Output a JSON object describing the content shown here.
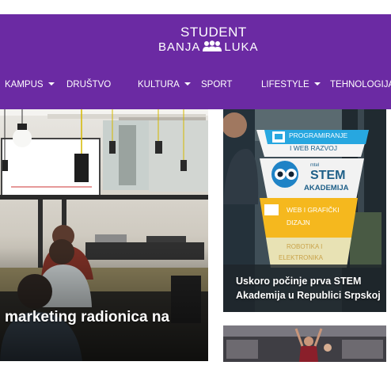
{
  "brand": {
    "line1": "STUDENT",
    "line2_left": "BANJA",
    "line2_right": "LUKA",
    "header_color": "#6b2aa3"
  },
  "nav": {
    "items": [
      {
        "label": "KAMPUS",
        "dropdown": true
      },
      {
        "label": "DRUŠTVO",
        "dropdown": false
      },
      {
        "label": "KULTURA",
        "dropdown": true
      },
      {
        "label": "SPORT",
        "dropdown": false
      },
      {
        "label": "LIFESTYLE",
        "dropdown": true
      },
      {
        "label": "TEHNOLOGIJA",
        "dropdown": false
      }
    ]
  },
  "featured": {
    "title": "marketing radionica na"
  },
  "side_card": {
    "title": "Uskoro počinje prva STEM Akademija u Republici Srpskoj",
    "poster": {
      "item1_line1": "PROGRAMIRANJE",
      "item1_line2": "I WEB RAZVOJ",
      "stem_small": "mtel",
      "stem_big": "STEM",
      "stem_sub": "AKADEMIJA",
      "item2_line1": "WEB I GRAFIČKI",
      "item2_line2": "DIZAJN",
      "item3_line1": "ROBOTIKA I",
      "item3_line2": "ELEKTRONIKA"
    }
  }
}
